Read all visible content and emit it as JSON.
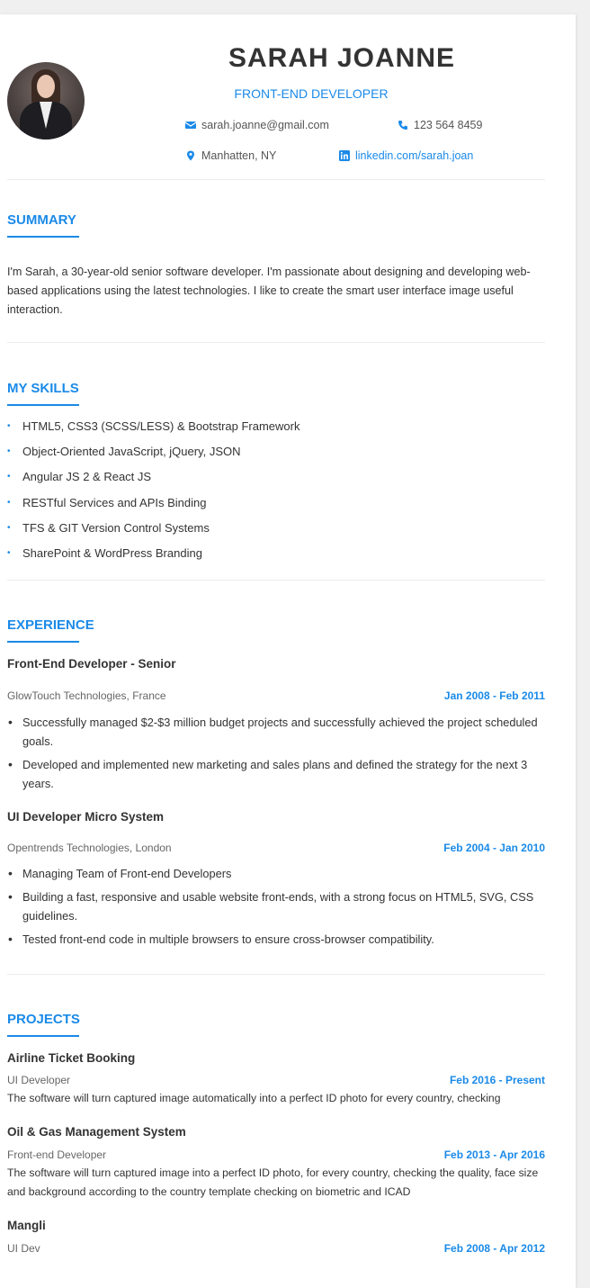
{
  "header": {
    "name": "SARAH JOANNE",
    "role": "FRONT-END DEVELOPER",
    "email": "sarah.joanne@gmail.com",
    "phone": "123 564 8459",
    "location": "Manhatten, NY",
    "linkedin": "linkedin.com/sarah.joan"
  },
  "summary": {
    "title": "SUMMARY",
    "text": "I'm Sarah, a 30-year-old senior software developer. I'm passionate about designing and developing web-based applications using the latest technologies. I like to create the smart user interface image useful interaction."
  },
  "skills": {
    "title": "MY SKILLS",
    "items": [
      "HTML5, CSS3 (SCSS/LESS) & Bootstrap Framework",
      "Object-Oriented JavaScript, jQuery, JSON",
      "Angular JS 2 & React JS",
      "RESTful Services and APIs Binding",
      "TFS & GIT Version Control Systems",
      "SharePoint & WordPress Branding"
    ]
  },
  "experience": {
    "title": "EXPERIENCE",
    "jobs": [
      {
        "title": "Front-End Developer - Senior",
        "company": "GlowTouch Technologies, France",
        "date": "Jan 2008 - Feb 2011",
        "bullets": [
          "Successfully managed $2-$3 million budget projects and successfully achieved the project scheduled goals.",
          "Developed and implemented new marketing and sales plans and defined the strategy for the next 3 years."
        ]
      },
      {
        "title": "UI Developer Micro System",
        "company": "Opentrends Technologies, London",
        "date": "Feb 2004 - Jan 2010",
        "bullets": [
          "Managing Team of Front-end Developers",
          "Building a fast, responsive and usable website front-ends, with a strong focus on HTML5, SVG, CSS guidelines.",
          "Tested front-end code in multiple browsers to ensure cross-browser compatibility."
        ]
      }
    ]
  },
  "projects": {
    "title": "PROJECTS",
    "items": [
      {
        "title": "Airline Ticket Booking",
        "role": "UI Developer",
        "date": "Feb 2016 - Present",
        "desc": "The software will turn captured image automatically into a perfect ID photo for every country, checking"
      },
      {
        "title": "Oil & Gas Management System",
        "role": "Front-end Developer",
        "date": "Feb 2013 - Apr 2016",
        "desc": "The software will turn captured image into a perfect ID photo, for every country, checking the quality, face size and background according to the country template checking on biometric and ICAD"
      },
      {
        "title": "Mangli",
        "role": "UI Dev",
        "date": "Feb 2008 - Apr 2012",
        "desc": ""
      }
    ]
  },
  "icons": {
    "email": "envelope-icon",
    "phone": "phone-icon",
    "location": "map-pin-icon",
    "linkedin": "linkedin-icon"
  },
  "colors": {
    "accent": "#1a8ae8",
    "text": "#333333",
    "muted": "#666666"
  }
}
